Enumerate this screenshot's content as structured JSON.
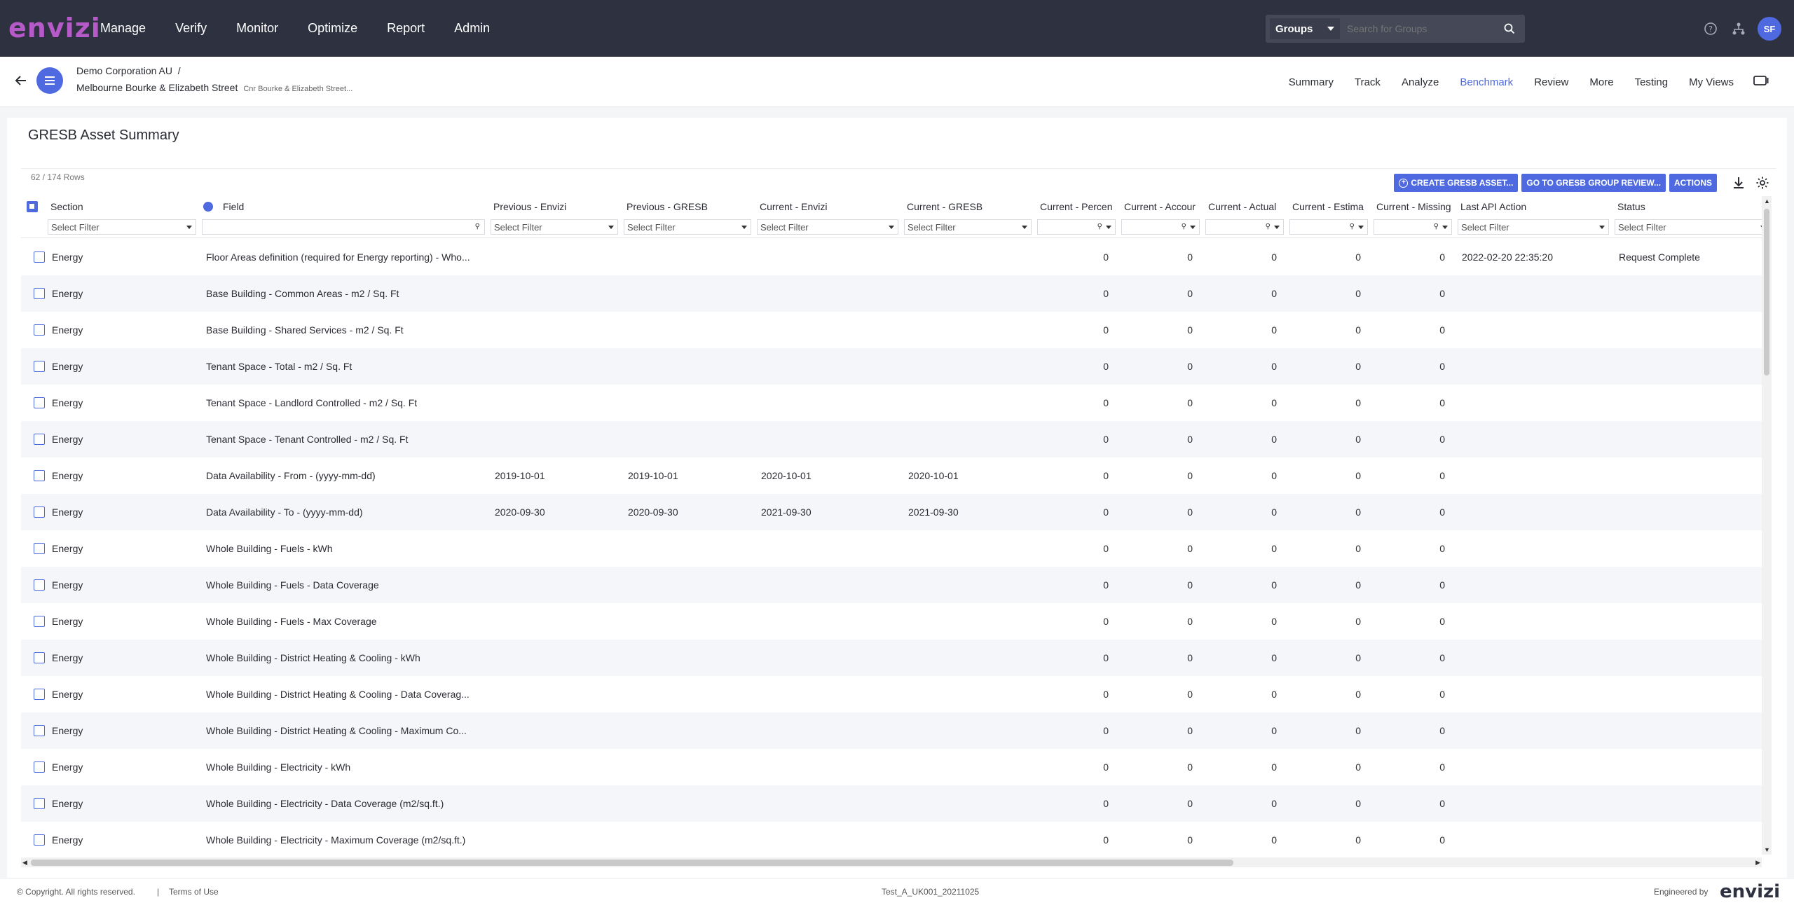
{
  "app": {
    "logo": "envizi",
    "footer_logo": "envizi"
  },
  "topnav": {
    "items": [
      {
        "label": "Manage"
      },
      {
        "label": "Verify"
      },
      {
        "label": "Monitor"
      },
      {
        "label": "Optimize"
      },
      {
        "label": "Report"
      },
      {
        "label": "Admin"
      }
    ],
    "group_select": "Groups",
    "search_placeholder": "Search for Groups",
    "avatar": "SF"
  },
  "breadcrumb": {
    "org": "Demo Corporation AU",
    "separator": "/",
    "site": "Melbourne Bourke & Elizabeth Street",
    "address": "Cnr Bourke & Elizabeth Street..."
  },
  "tabs": [
    {
      "label": "Summary"
    },
    {
      "label": "Track"
    },
    {
      "label": "Analyze"
    },
    {
      "label": "Benchmark",
      "active": true
    },
    {
      "label": "Review"
    },
    {
      "label": "More"
    },
    {
      "label": "Testing"
    },
    {
      "label": "My Views"
    }
  ],
  "panel": {
    "title": "GRESB Asset Summary",
    "row_count": "62 / 174 Rows",
    "buttons": {
      "create": "CREATE GRESB ASSET...",
      "goto": "GO TO GRESB GROUP REVIEW...",
      "actions": "ACTIONS"
    }
  },
  "table": {
    "columns": [
      "Section",
      "Field",
      "Previous - Envizi",
      "Previous - GRESB",
      "Current - Envizi",
      "Current - GRESB",
      "Current - Percen",
      "Current - Accour",
      "Current - Actual",
      "Current - Estima",
      "Current - Missing",
      "Last API Action",
      "Status"
    ],
    "filter_placeholder": "Select Filter",
    "rows": [
      [
        "Energy",
        "Floor Areas definition (required for Energy reporting) - Who...",
        "",
        "",
        "",
        "",
        "0",
        "0",
        "0",
        "0",
        "0",
        "2022-02-20 22:35:20",
        "Request Complete"
      ],
      [
        "Energy",
        "Base Building - Common Areas - m2 / Sq. Ft",
        "",
        "",
        "",
        "",
        "0",
        "0",
        "0",
        "0",
        "0",
        "",
        ""
      ],
      [
        "Energy",
        "Base Building - Shared Services - m2 / Sq. Ft",
        "",
        "",
        "",
        "",
        "0",
        "0",
        "0",
        "0",
        "0",
        "",
        ""
      ],
      [
        "Energy",
        "Tenant Space - Total - m2 / Sq. Ft",
        "",
        "",
        "",
        "",
        "0",
        "0",
        "0",
        "0",
        "0",
        "",
        ""
      ],
      [
        "Energy",
        "Tenant Space - Landlord Controlled - m2 / Sq. Ft",
        "",
        "",
        "",
        "",
        "0",
        "0",
        "0",
        "0",
        "0",
        "",
        ""
      ],
      [
        "Energy",
        "Tenant Space - Tenant Controlled - m2 / Sq. Ft",
        "",
        "",
        "",
        "",
        "0",
        "0",
        "0",
        "0",
        "0",
        "",
        ""
      ],
      [
        "Energy",
        "Data Availability - From - (yyyy-mm-dd)",
        "2019-10-01",
        "2019-10-01",
        "2020-10-01",
        "2020-10-01",
        "0",
        "0",
        "0",
        "0",
        "0",
        "",
        ""
      ],
      [
        "Energy",
        "Data Availability - To - (yyyy-mm-dd)",
        "2020-09-30",
        "2020-09-30",
        "2021-09-30",
        "2021-09-30",
        "0",
        "0",
        "0",
        "0",
        "0",
        "",
        ""
      ],
      [
        "Energy",
        "Whole Building - Fuels - kWh",
        "",
        "",
        "",
        "",
        "0",
        "0",
        "0",
        "0",
        "0",
        "",
        ""
      ],
      [
        "Energy",
        "Whole Building - Fuels - Data Coverage",
        "",
        "",
        "",
        "",
        "0",
        "0",
        "0",
        "0",
        "0",
        "",
        ""
      ],
      [
        "Energy",
        "Whole Building - Fuels - Max Coverage",
        "",
        "",
        "",
        "",
        "0",
        "0",
        "0",
        "0",
        "0",
        "",
        ""
      ],
      [
        "Energy",
        "Whole Building - District Heating & Cooling - kWh",
        "",
        "",
        "",
        "",
        "0",
        "0",
        "0",
        "0",
        "0",
        "",
        ""
      ],
      [
        "Energy",
        "Whole Building - District Heating & Cooling - Data Coverag...",
        "",
        "",
        "",
        "",
        "0",
        "0",
        "0",
        "0",
        "0",
        "",
        ""
      ],
      [
        "Energy",
        "Whole Building - District Heating & Cooling - Maximum Co...",
        "",
        "",
        "",
        "",
        "0",
        "0",
        "0",
        "0",
        "0",
        "",
        ""
      ],
      [
        "Energy",
        "Whole Building - Electricity - kWh",
        "",
        "",
        "",
        "",
        "0",
        "0",
        "0",
        "0",
        "0",
        "",
        ""
      ],
      [
        "Energy",
        "Whole Building - Electricity - Data Coverage (m2/sq.ft.)",
        "",
        "",
        "",
        "",
        "0",
        "0",
        "0",
        "0",
        "0",
        "",
        ""
      ],
      [
        "Energy",
        "Whole Building - Electricity - Maximum Coverage (m2/sq.ft.)",
        "",
        "",
        "",
        "",
        "0",
        "0",
        "0",
        "0",
        "0",
        "",
        ""
      ]
    ]
  },
  "footer": {
    "copyright": "© Copyright. All rights reserved.",
    "separator": "|",
    "terms": "Terms of Use",
    "environment": "Test_A_UK001_20211025",
    "engineered_by": "Engineered by"
  },
  "colors": {
    "accent": "#4f6ae0",
    "nav_bg": "#2e3140",
    "logo": "#b659c9"
  }
}
